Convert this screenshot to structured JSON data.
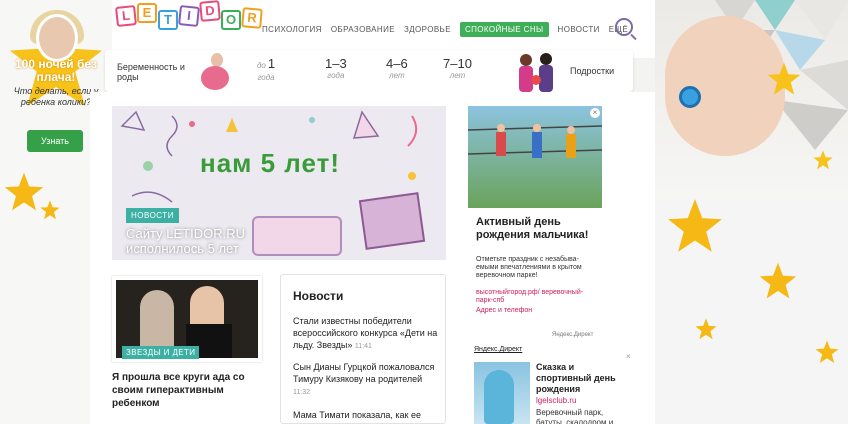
{
  "left_promo": {
    "headline": "100 ночей без плача!",
    "subtext": "Что делать, если у ребенка колики?",
    "button_label": "Узнать"
  },
  "header": {
    "logo_letters": [
      {
        "ch": "L",
        "color": "#e84a7a"
      },
      {
        "ch": "E",
        "color": "#f0a020"
      },
      {
        "ch": "T",
        "color": "#3aa0d8"
      },
      {
        "ch": "I",
        "color": "#8a5ab8"
      },
      {
        "ch": "D",
        "color": "#e84a7a"
      },
      {
        "ch": "O",
        "color": "#3aae58"
      },
      {
        "ch": "R",
        "color": "#f0a020"
      }
    ],
    "nav": [
      {
        "label": "Психология",
        "active": false
      },
      {
        "label": "Образование",
        "active": false
      },
      {
        "label": "Здоровье",
        "active": false
      },
      {
        "label": "Спокойные сны",
        "active": true
      },
      {
        "label": "Новости",
        "active": false
      },
      {
        "label": "Ещё",
        "active": false
      }
    ]
  },
  "age_bar": {
    "left_label": "Беременность и роды",
    "ages": [
      {
        "prefix": "до",
        "value": "1",
        "unit": "года"
      },
      {
        "prefix": "",
        "value": "1–3",
        "unit": "года"
      },
      {
        "prefix": "",
        "value": "4–6",
        "unit": "лет"
      },
      {
        "prefix": "",
        "value": "7–10",
        "unit": "лет"
      }
    ],
    "right_label": "Подростки"
  },
  "hero": {
    "banner_text": "нам 5 лет!",
    "badge": "НОВОСТИ",
    "caption": "Сайту LETIDOR.RU исполнилось 5 лет"
  },
  "ad_right": {
    "close": "×",
    "title": "Активный день рождения мальчика!",
    "description": "Отметьте праздник с незабыва-емыми впечатлениями в крытом веревочном парке!",
    "url": "высотныйгород.рф/ веревочный-парк-спб",
    "contact": "Адрес и телефон",
    "source": "Яндекс.Директ"
  },
  "card_left": {
    "tag": "ЗВЕЗДЫ И ДЕТИ",
    "headline": "Я прошла все круги ада со своим гиперактивным ребенком"
  },
  "news": {
    "title": "Новости",
    "items": [
      {
        "text": "Стали известны победители всероссийского конкурса «Дети на льду. Звезды»",
        "time": "11:41"
      },
      {
        "text": "Сын Дианы Гурцкой пожаловался Тимуру Кизякову на родителей",
        "time": "11:32"
      },
      {
        "text": "Мама Тимати показала, как ее",
        "time": ""
      }
    ]
  },
  "ad_bottom": {
    "label": "Яндекс.Директ",
    "close": "×",
    "title": "Сказка и спортивный день рождения",
    "url": "lgelsclub.ru",
    "description": "Веревочный парк, батуты, скалодром и"
  }
}
